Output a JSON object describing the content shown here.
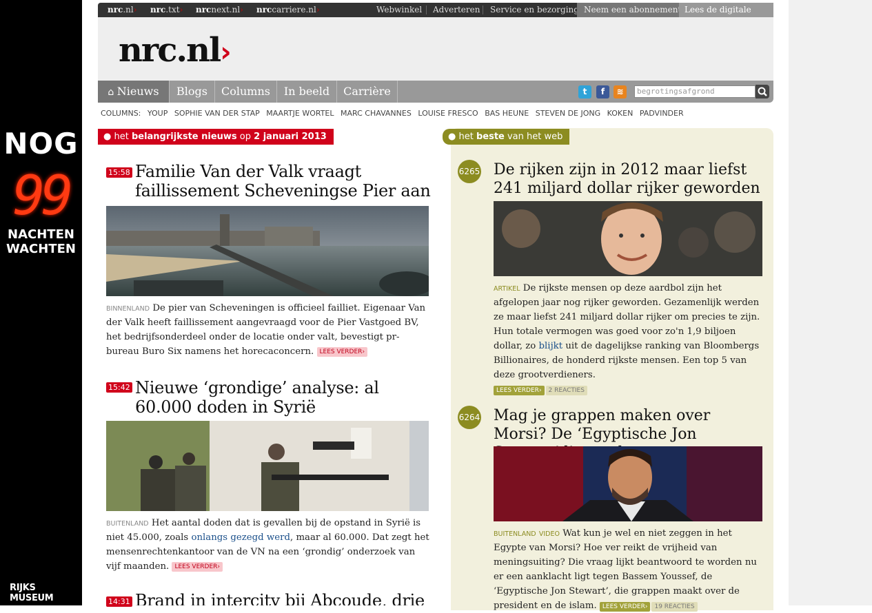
{
  "left_ad": {
    "top": "NOG",
    "number": "99",
    "line1": "NACHTEN",
    "line2": "WACHTEN",
    "sponsor": "RIJKS MUSEUM"
  },
  "topbar": {
    "sites": [
      {
        "bold": "nrc",
        "rest": ".nl"
      },
      {
        "bold": "nrc",
        "rest": ".txt"
      },
      {
        "bold": "nrc",
        "rest": "next.nl"
      },
      {
        "bold": "nrc",
        "rest": "carriere.nl"
      }
    ],
    "links": [
      "Webwinkel",
      "Adverteren",
      "Service en bezorging",
      "Neem een abonnement",
      "Lees de digitale editie"
    ]
  },
  "logo": {
    "name": "nrc",
    "dot": ".",
    "tld": "nl"
  },
  "nav": {
    "items": [
      "Nieuws",
      "Blogs",
      "Columns",
      "In beeld",
      "Carrière"
    ]
  },
  "search": {
    "value": "begrotingsafgrond"
  },
  "columns": {
    "label": "COLUMNS:",
    "items": [
      "YOUP",
      "SOPHIE VAN DER STAP",
      "MAARTJE WORTEL",
      "MARC CHAVANNES",
      "LOUISE FRESCO",
      "BAS HEUNE",
      "STEVEN DE JONG",
      "KOKEN",
      "PADVINDER"
    ]
  },
  "left_section": {
    "pre": "het ",
    "strong": "belangrijkste nieuws",
    "mid": " op ",
    "date": "2 januari 2013"
  },
  "right_section": {
    "pre": "het ",
    "strong": "beste",
    "post": " van het web"
  },
  "news": [
    {
      "time": "15:58",
      "title": "Familie Van der Valk vraagt faillissement Scheveningse Pier aan",
      "category": "BINNENLAND",
      "text": "De pier van Scheveningen is officieel failliet. Eigenaar Van der Valk heeft faillissement aangevraagd voor de Pier Vastgoed BV, het bedrijfsonderdeel onder de locatie onder valt, bevestigt pr-bureau Buro Six namens het horecaconcern.",
      "more": "LEES VERDER"
    },
    {
      "time": "15:42",
      "title": "Nieuwe ‘grondige’ analyse: al 60.000 doden in Syrië",
      "category": "BUITENLAND",
      "text_pre": "Het aantal doden dat is gevallen bij de opstand in Syrië is niet 45.000, zoals ",
      "link": "onlangs gezegd werd",
      "text_post": ", maar al 60.000. Dat zegt het mensenrechtenkantoor van de VN na een ‘grondig’ onderzoek van vijf maanden.",
      "more": "LEES VERDER"
    },
    {
      "time": "14:31",
      "title": "Brand in intercity bij Abcoude, drie"
    }
  ],
  "web": [
    {
      "number": "6265",
      "title": "De rijken zijn in 2012 maar liefst 241 miljard dollar rijker geworden",
      "category": "ARTIKEL",
      "text_pre": "De rijkste mensen op deze aardbol zijn het afgelopen jaar nog rijker geworden. Gezamenlijk werden ze maar liefst 241 miljard dollar rijker om precies te zijn. Hun totale vermogen was goed voor zo'n 1,9 biljoen dollar, zo ",
      "link": "blijkt",
      "text_post": " uit de dagelijkse ranking van Bloombergs Billionaires, de honderd rijkste mensen. Een top 5 van deze grootverdieners.",
      "more": "LEES VERDER",
      "reactions": "2 REACTIES"
    },
    {
      "number": "6264",
      "title": "Mag je grappen maken over Morsi? De ‘Egyptische Jon Stewart’ ligt onder vuur",
      "category": "BUITENLAND",
      "category2": "VIDEO",
      "text": "Wat kun je wel en niet zeggen in het Egypte van Morsi? Hoe ver reikt de vrijheid van meningsuiting? Die vraag lijkt beantwoord te worden nu er een aanklacht ligt tegen Bassem Youssef, de ‘Egyptische Jon Stewart’, die grappen maakt over de president en de islam.",
      "more": "LEES VERDER",
      "reactions": "19 REACTIES"
    }
  ]
}
